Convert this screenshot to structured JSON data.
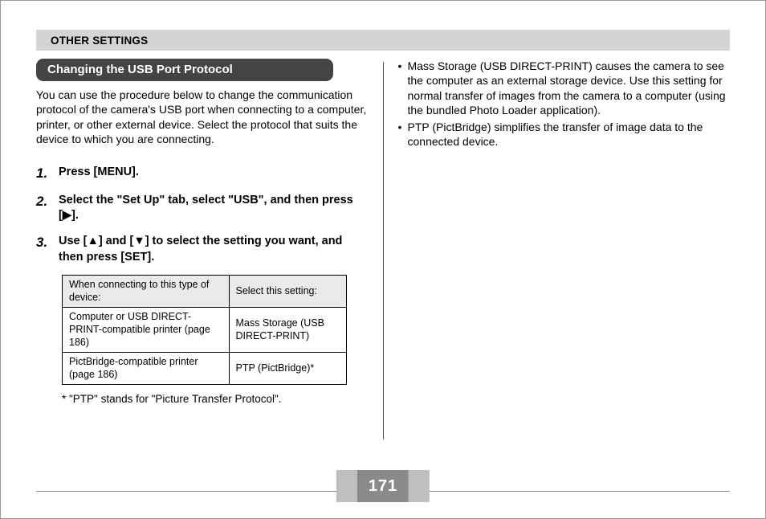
{
  "header": {
    "title": "OTHER SETTINGS"
  },
  "section": {
    "title": "Changing the USB Port Protocol"
  },
  "intro": "You can use the procedure below to change the communication protocol of the camera's USB port when connecting to a computer, printer, or other external device. Select the protocol that suits the device to which you are connecting.",
  "steps": [
    {
      "num": "1.",
      "text": "Press [MENU]."
    },
    {
      "num": "2.",
      "text_pre": "Select the \"Set Up\" tab, select \"USB\", and then press [",
      "icon": "▶",
      "text_post": "]."
    },
    {
      "num": "3.",
      "text_pre": "Use [",
      "icon1": "▲",
      "text_mid": "] and [",
      "icon2": "▼",
      "text_post": "] to select the setting you want, and then press [SET]."
    }
  ],
  "table": {
    "headers": [
      "When connecting to this type of device:",
      "Select this setting:"
    ],
    "rows": [
      [
        "Computer or USB DIRECT-PRINT-compatible printer (page 186)",
        "Mass Storage (USB DIRECT-PRINT)"
      ],
      [
        "PictBridge-compatible printer (page 186)",
        "PTP (PictBridge)*"
      ]
    ]
  },
  "footnote": "* \"PTP\" stands for \"Picture Transfer Protocol\".",
  "bullets": [
    "Mass Storage (USB DIRECT-PRINT) causes the camera to see the computer as an external storage device. Use this setting for normal transfer of images from the camera to a computer (using the bundled Photo Loader application).",
    "PTP (PictBridge) simplifies the transfer of image data to the connected device."
  ],
  "page_number": "171"
}
